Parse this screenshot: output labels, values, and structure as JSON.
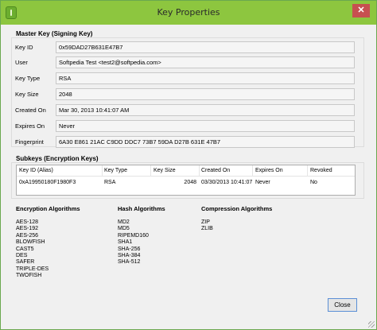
{
  "window": {
    "title": "Key Properties",
    "close_glyph": "✕"
  },
  "master": {
    "heading": "Master Key (Signing Key)",
    "fields": [
      {
        "label": "Key ID",
        "value": "0x59DAD27B631E47B7"
      },
      {
        "label": "User",
        "value": "Softpedia Test <test2@softpedia.com>"
      },
      {
        "label": "Key Type",
        "value": "RSA"
      },
      {
        "label": "Key Size",
        "value": "2048"
      },
      {
        "label": "Created On",
        "value": "Mar 30, 2013 10:41:07 AM"
      },
      {
        "label": "Expires On",
        "value": "Never"
      },
      {
        "label": "Fingerprint",
        "value": "6A30 E861 21AC C9DD DDC7 73B7 59DA D27B 631E 47B7"
      }
    ]
  },
  "subkeys": {
    "heading": "Subkeys (Encryption Keys)",
    "columns": [
      "Key ID (Alias)",
      "Key Type",
      "Key Size",
      "Created On",
      "Expires On",
      "Revoked"
    ],
    "rows": [
      [
        "0xA19950180F1980F3",
        "RSA",
        "2048",
        "03/30/2013 10:41:07",
        "Never",
        "No"
      ]
    ]
  },
  "algorithms": {
    "encryption": {
      "heading": "Encryption Algorithms",
      "items": [
        "AES-128",
        "AES-192",
        "AES-256",
        "BLOWFISH",
        "CAST5",
        "DES",
        "SAFER",
        "TRIPLE-DES",
        "TWOFISH"
      ]
    },
    "hash": {
      "heading": "Hash Algorithms",
      "items": [
        "MD2",
        "MD5",
        "RIPEMD160",
        "SHA1",
        "SHA-256",
        "SHA-384",
        "SHA-512"
      ]
    },
    "compression": {
      "heading": "Compression Algorithms",
      "items": [
        "ZIP",
        "ZLIB"
      ]
    }
  },
  "buttons": {
    "close_label": "Close"
  },
  "colors": {
    "titlebar": "#8dc63f",
    "close_button": "#c75050",
    "dialog_background": "#f0f0f0"
  }
}
